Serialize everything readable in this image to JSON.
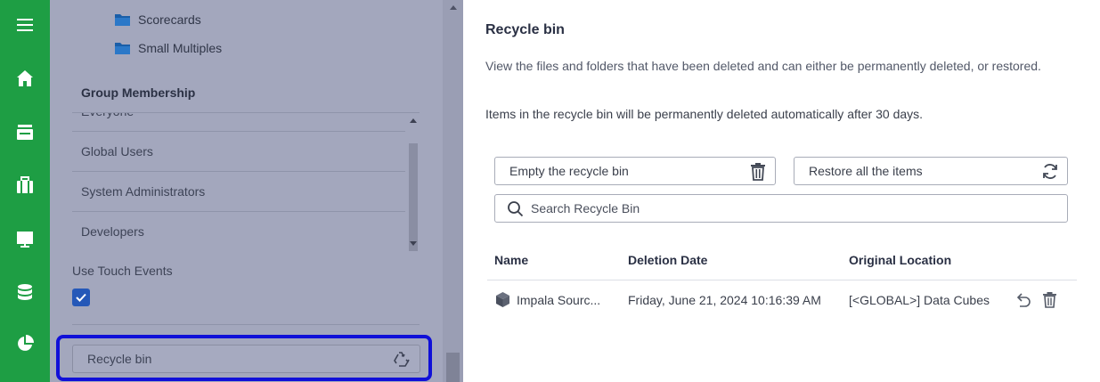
{
  "rail": {
    "icons": [
      "menu-icon",
      "home-icon",
      "archive-icon",
      "briefcase-icon",
      "presentation-icon",
      "database-icon",
      "pie-chart-icon"
    ],
    "color": "#1e9e44"
  },
  "panel": {
    "folders": [
      "Scorecards",
      "Small Multiples"
    ],
    "group_membership": {
      "title": "Group Membership",
      "items": [
        "Everyone",
        "Global Users",
        "System Administrators",
        "Developers"
      ]
    },
    "touch_events": {
      "label": "Use Touch Events",
      "checked": true
    },
    "recycle_bin_label": "Recycle bin"
  },
  "drawer": {
    "title": "Recycle bin",
    "description": "View the files and folders that have been deleted and can either be permanently deleted, or restored.",
    "note": "Items in the recycle bin will be permanently deleted automatically after 30 days.",
    "empty_label": "Empty the recycle bin",
    "restore_label": "Restore all the items",
    "search_placeholder": "Search Recycle Bin",
    "columns": [
      "Name",
      "Deletion Date",
      "Original Location"
    ],
    "rows": [
      {
        "name": "Impala Sourc...",
        "date": "Friday, June 21, 2024 10:16:39 AM",
        "location": "[<GLOBAL>] Data Cubes"
      }
    ]
  },
  "colors": {
    "accent": "#1e9e44",
    "highlight_border": "#1010d8",
    "checkbox": "#2558b8"
  }
}
